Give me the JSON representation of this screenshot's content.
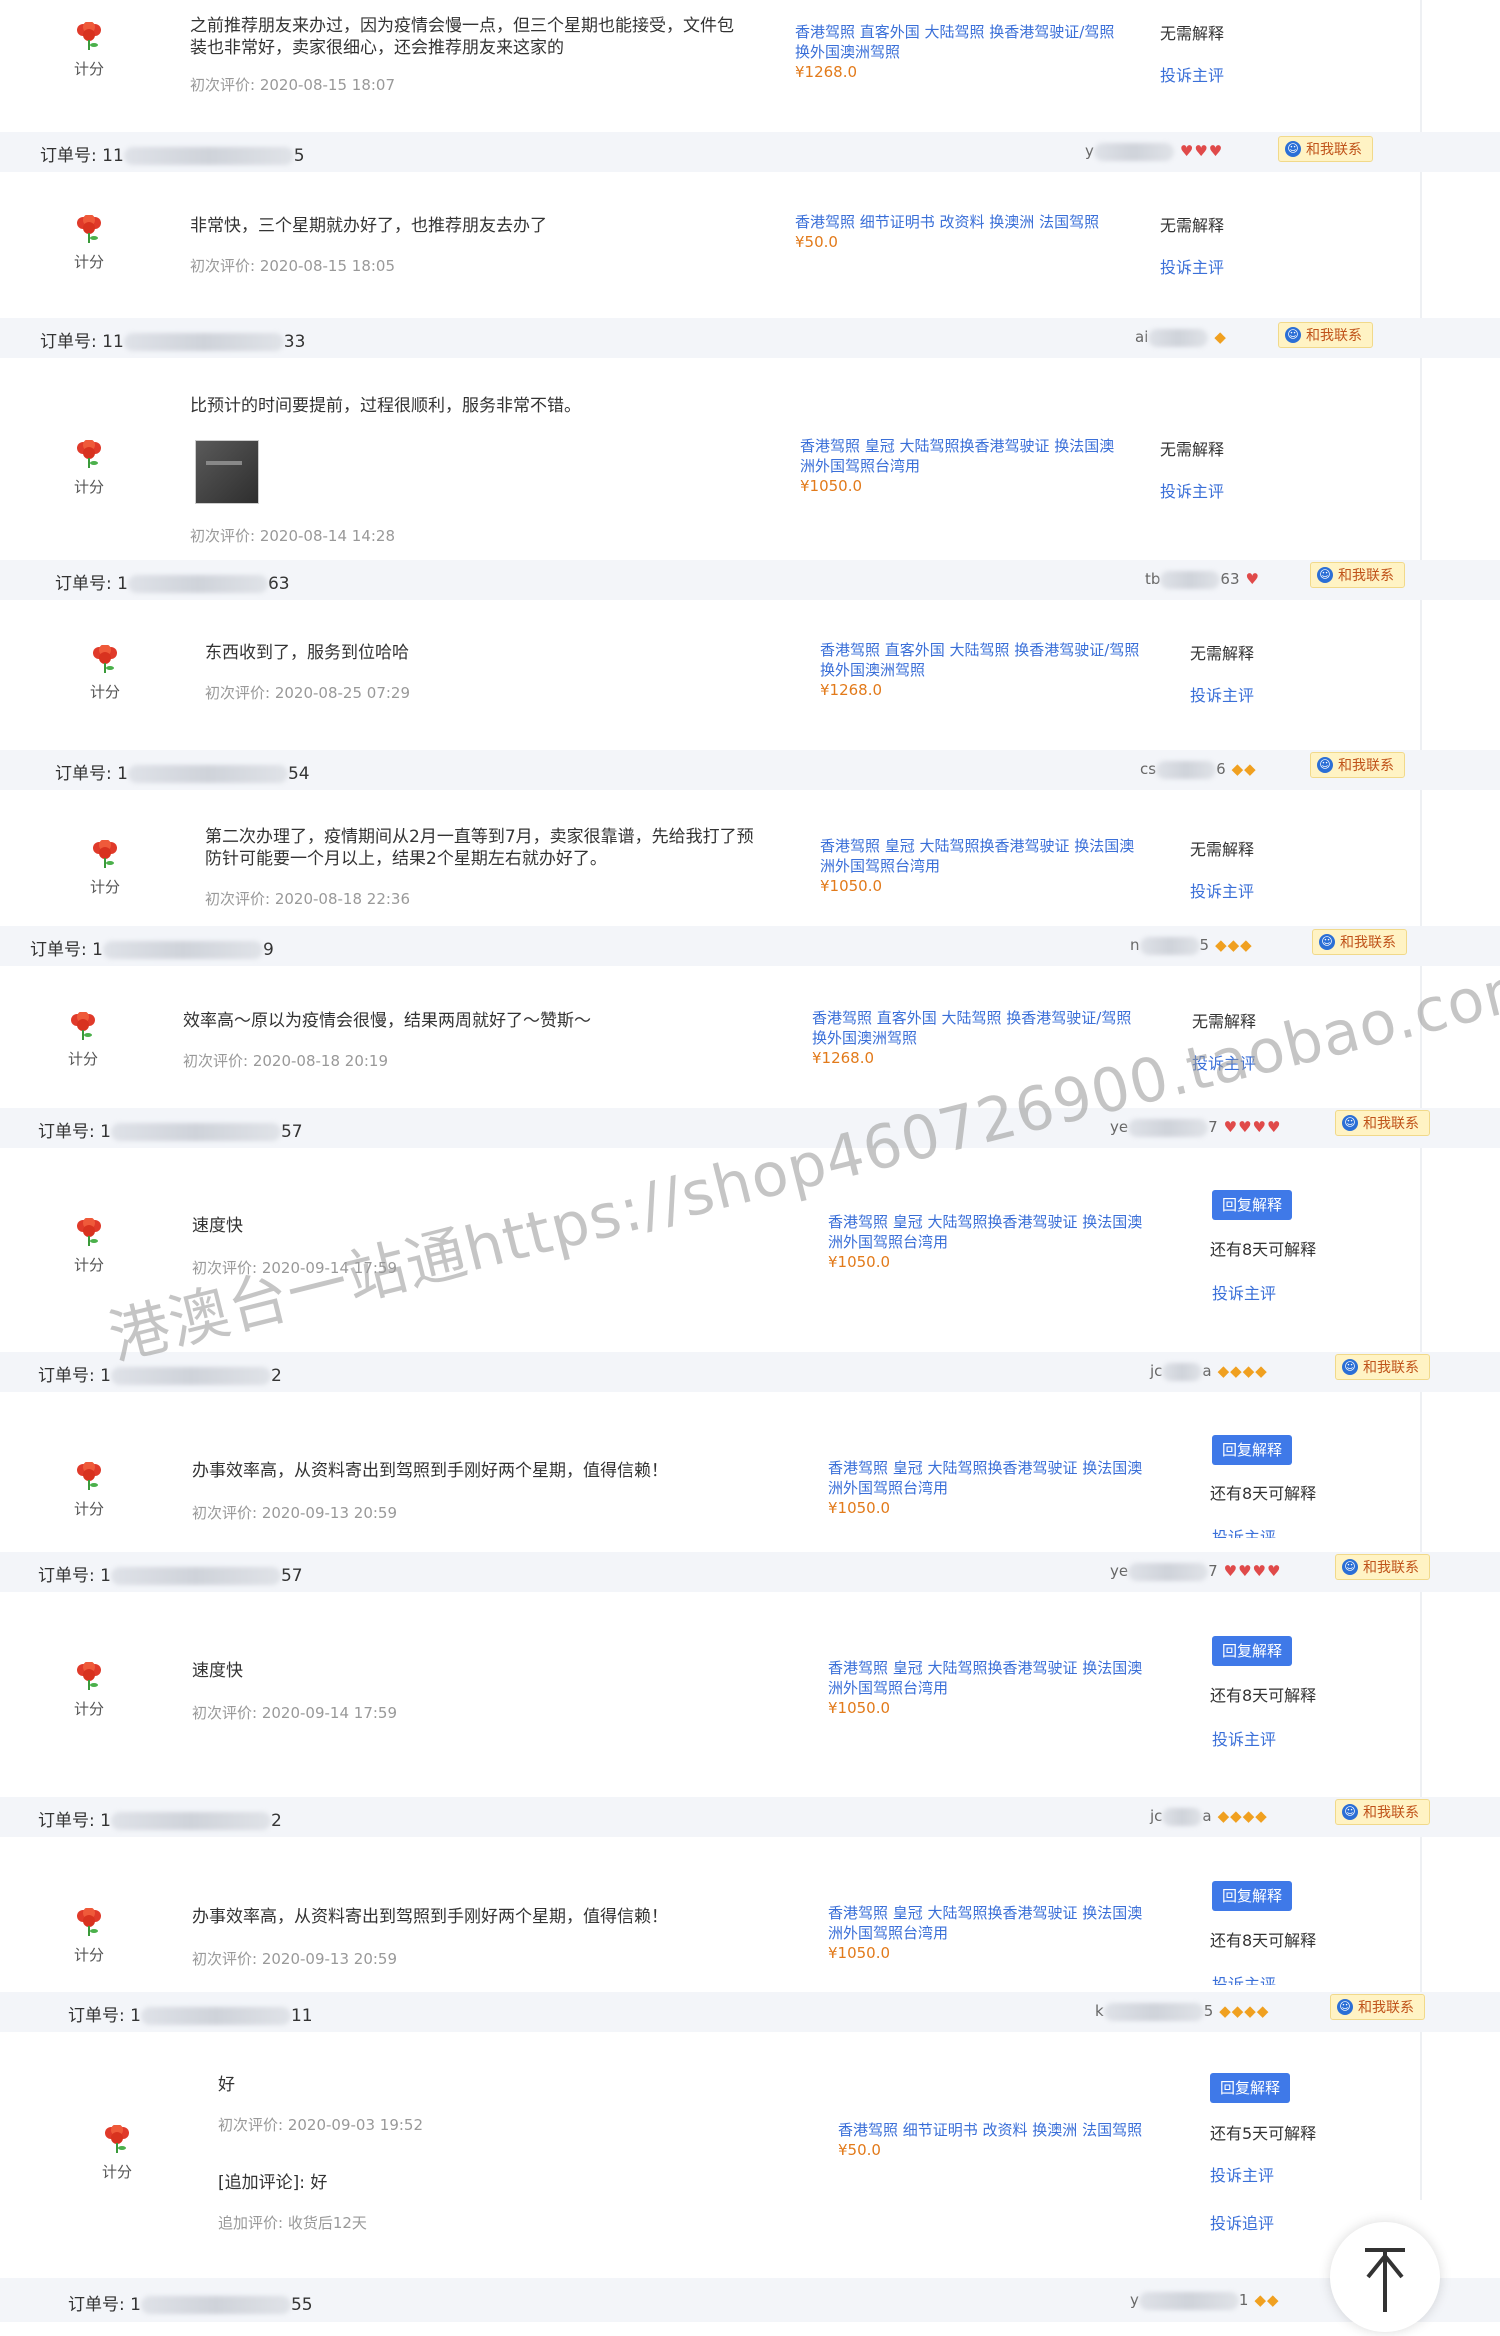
{
  "labels": {
    "score": "计分",
    "order_prefix": "订单号:",
    "first_review_prefix": "初次评价:",
    "no_explain": "无需解释",
    "complain": "投诉主评",
    "complain_followup": "投诉追评",
    "contact": "和我联系",
    "reply_explain": "回复解释",
    "followup_prefix": "[追加评论]:",
    "followup_time_prefix": "追加评价:"
  },
  "watermark": "港澳台一站通https://shop460726900.taobao.com",
  "rows": [
    {
      "comment": "之前推荐朋友来办过，因为疫情会慢一点，但三个星期也能接受，文件包装也非常好，卖家很细心，还会推荐朋友来这家的",
      "time": "2020-08-15 18:07",
      "product": "香港驾照 直客外国 大陆驾照 换香港驾驶证/驾照 换外国澳洲驾照",
      "price": "¥1268.0",
      "status": "无需解释",
      "action": "投诉主评",
      "order": {
        "prefix": "11",
        "suffix": "5",
        "buyer_prefix": "y",
        "buyer_suffix": "",
        "rank": "♥♥♥",
        "rank_type": "hearts"
      }
    },
    {
      "comment": "非常快，三个星期就办好了，也推荐朋友去办了",
      "time": "2020-08-15 18:05",
      "product": "香港驾照 细节证明书 改资料 换澳洲 法国驾照",
      "price": "¥50.0",
      "status": "无需解释",
      "action": "投诉主评",
      "order": {
        "prefix": "11",
        "suffix": "33",
        "buyer_prefix": "ai",
        "buyer_suffix": "",
        "rank": "◆",
        "rank_type": "diam"
      }
    },
    {
      "comment": "比预计的时间要提前，过程很顺利，服务非常不错。",
      "time": "2020-08-14 14:28",
      "product": "香港驾照 皇冠 大陆驾照换香港驾驶证 换法国澳洲外国驾照台湾用",
      "price": "¥1050.0",
      "status": "无需解释",
      "action": "投诉主评",
      "order": {
        "prefix": "1",
        "suffix": "63",
        "buyer_prefix": "tb",
        "buyer_suffix": "63",
        "rank": "♥",
        "rank_type": "hearts"
      }
    },
    {
      "comment": "东西收到了，服务到位哈哈",
      "time": "2020-08-25 07:29",
      "product": "香港驾照 直客外国 大陆驾照 换香港驾驶证/驾照 换外国澳洲驾照",
      "price": "¥1268.0",
      "status": "无需解释",
      "action": "投诉主评",
      "order": {
        "prefix": "1",
        "suffix": "54",
        "buyer_prefix": "cs",
        "buyer_suffix": "6",
        "rank": "◆◆",
        "rank_type": "diam"
      }
    },
    {
      "comment": "第二次办理了，疫情期间从2月一直等到7月，卖家很靠谱，先给我打了预防针可能要一个月以上，结果2个星期左右就办好了。",
      "time": "2020-08-18 22:36",
      "product": "香港驾照 皇冠 大陆驾照换香港驾驶证 换法国澳洲外国驾照台湾用",
      "price": "¥1050.0",
      "status": "无需解释",
      "action": "投诉主评",
      "order": {
        "prefix": "1",
        "suffix": "9",
        "buyer_prefix": "n",
        "buyer_suffix": "5",
        "rank": "◆◆◆",
        "rank_type": "diam"
      }
    },
    {
      "comment": "效率高～原以为疫情会很慢，结果两周就好了～赞斯～",
      "time": "2020-08-18 20:19",
      "product": "香港驾照 直客外国 大陆驾照 换香港驾驶证/驾照 换外国澳洲驾照",
      "price": "¥1268.0",
      "status": "无需解释",
      "action": "投诉主评",
      "order": {
        "prefix": "1",
        "suffix": "57",
        "buyer_prefix": "ye",
        "buyer_suffix": "7",
        "rank": "♥♥♥♥",
        "rank_type": "hearts"
      }
    },
    {
      "comment": "速度快",
      "time": "2020-09-14 17:59",
      "product": "香港驾照 皇冠 大陆驾照换香港驾驶证 换法国澳洲外国驾照台湾用",
      "price": "¥1050.0",
      "status": "还有8天可解释",
      "action": "投诉主评",
      "order": {
        "prefix": "1",
        "suffix": "2",
        "buyer_prefix": "jc",
        "buyer_suffix": "a",
        "rank": "◆◆◆◆",
        "rank_type": "diam"
      }
    },
    {
      "comment": "办事效率高，从资料寄出到驾照到手刚好两个星期，值得信赖！",
      "time": "2020-09-13 20:59",
      "product": "香港驾照 皇冠 大陆驾照换香港驾驶证 换法国澳洲外国驾照台湾用",
      "price": "¥1050.0",
      "status": "还有8天可解释",
      "action": "投诉主评",
      "order": {
        "prefix": "1",
        "suffix": "57",
        "buyer_prefix": "ye",
        "buyer_suffix": "7",
        "rank": "♥♥♥♥",
        "rank_type": "hearts"
      }
    },
    {
      "comment": "速度快",
      "time": "2020-09-14 17:59",
      "product": "香港驾照 皇冠 大陆驾照换香港驾驶证 换法国澳洲外国驾照台湾用",
      "price": "¥1050.0",
      "status": "还有8天可解释",
      "action": "投诉主评",
      "order": {
        "prefix": "1",
        "suffix": "2",
        "buyer_prefix": "jc",
        "buyer_suffix": "a",
        "rank": "◆◆◆◆",
        "rank_type": "diam"
      }
    },
    {
      "comment": "办事效率高，从资料寄出到驾照到手刚好两个星期，值得信赖！",
      "time": "2020-09-13 20:59",
      "product": "香港驾照 皇冠 大陆驾照换香港驾驶证 换法国澳洲外国驾照台湾用",
      "price": "¥1050.0",
      "status": "还有8天可解释",
      "action": "投诉主评",
      "order": {
        "prefix": "1",
        "suffix": "11",
        "buyer_prefix": "k",
        "buyer_suffix": "5",
        "rank": "◆◆◆◆",
        "rank_type": "diam"
      }
    },
    {
      "comment": "好",
      "time": "2020-09-03 19:52",
      "product": "香港驾照 细节证明书 改资料 换澳洲 法国驾照",
      "price": "¥50.0",
      "status": "还有5天可解释",
      "action": "投诉主评",
      "followup": "好",
      "followup_time": "收货后12天",
      "order": {
        "prefix": "1",
        "suffix": "55",
        "buyer_prefix": "y",
        "buyer_suffix": "1",
        "rank": "◆◆",
        "rank_type": "diam"
      }
    }
  ]
}
